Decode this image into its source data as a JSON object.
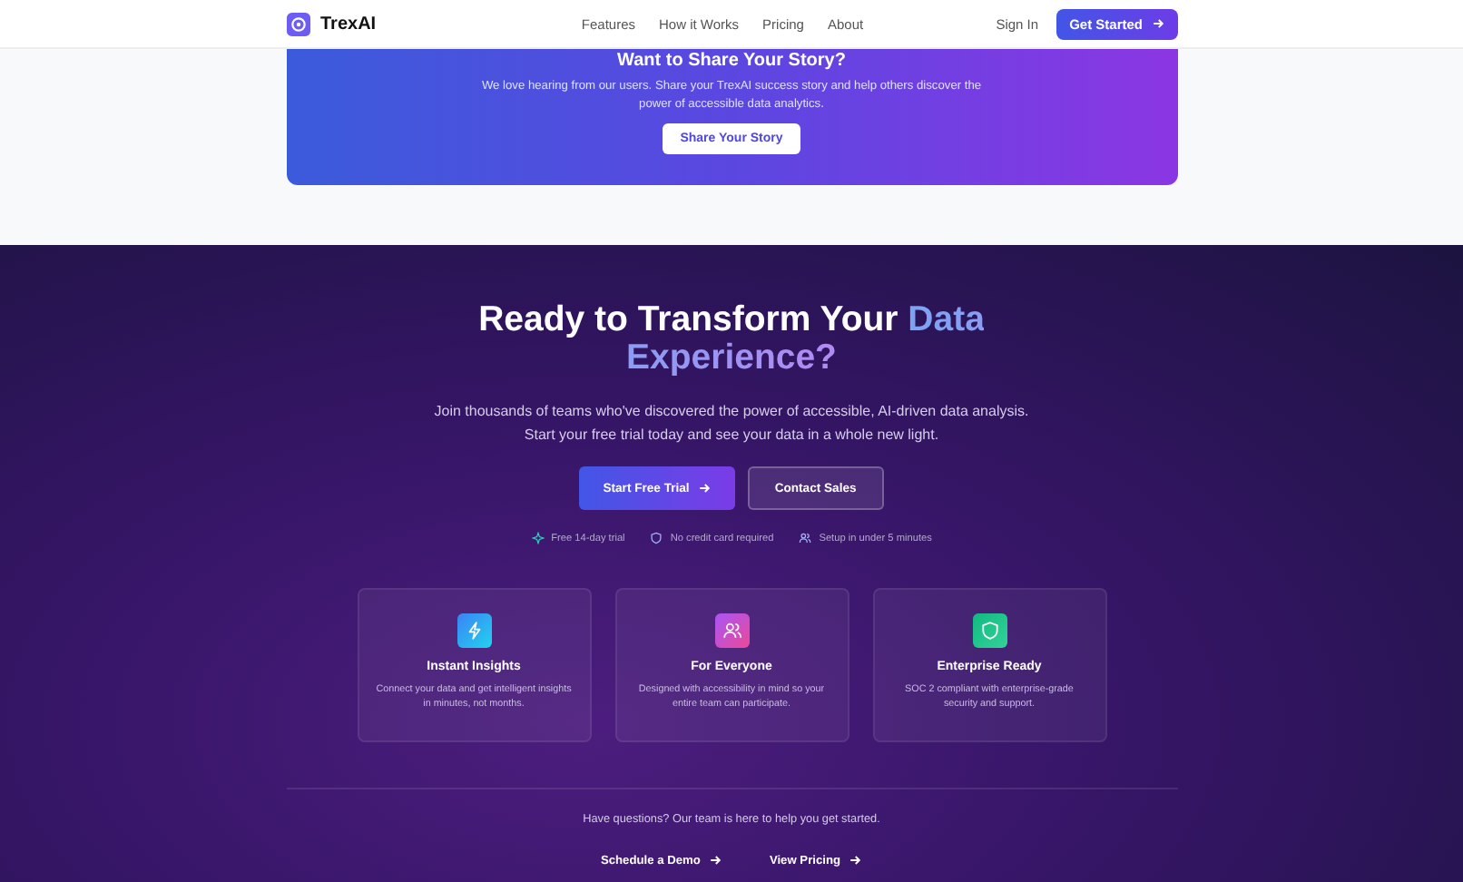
{
  "nav": {
    "brand": "TrexAI",
    "links": [
      "Features",
      "How it Works",
      "Pricing",
      "About"
    ],
    "sign_in": "Sign In",
    "cta": "Get Started"
  },
  "story": {
    "title": "Want to Share Your Story?",
    "text": "We love hearing from our users. Share your TrexAI success story and help others discover the power of accessible data analytics.",
    "button": "Share Your Story"
  },
  "cta": {
    "title": "Ready to Transform Your",
    "title_highlight": "Data Experience?",
    "text": "Join thousands of teams who've discovered the power of accessible, AI-driven data analysis. Start your free trial today and see your data in a whole new light.",
    "primary": "Start Free Trial",
    "secondary": "Contact Sales",
    "perks": [
      {
        "kind": "sparkle",
        "label": "Free 14-day trial"
      },
      {
        "kind": "shield",
        "label": "No credit card required"
      },
      {
        "kind": "users",
        "label": "Setup in under 5 minutes"
      }
    ],
    "features": [
      {
        "kind": "bolt",
        "title": "Instant Insights",
        "text": "Connect your data and get intelligent insights in minutes, not months."
      },
      {
        "kind": "users",
        "title": "For Everyone",
        "text": "Designed with accessibility in mind so your entire team can participate."
      },
      {
        "kind": "shield",
        "title": "Enterprise Ready",
        "text": "SOC 2 compliant with enterprise-grade security and support."
      }
    ],
    "question": "Have questions? Our team is here to help you get started.",
    "links": [
      "Schedule a Demo",
      "View Pricing"
    ]
  }
}
